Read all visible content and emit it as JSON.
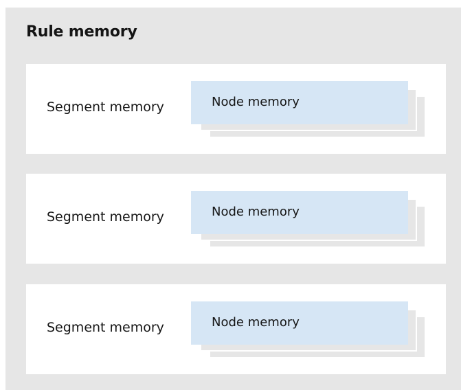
{
  "diagram": {
    "title": "Rule memory",
    "segments": [
      {
        "label": "Segment memory",
        "node_label": "Node memory"
      },
      {
        "label": "Segment memory",
        "node_label": "Node memory"
      },
      {
        "label": "Segment memory",
        "node_label": "Node memory"
      }
    ],
    "colors": {
      "outer_background": "#e6e6e6",
      "segment_background": "#ffffff",
      "node_background": "#d6e6f5",
      "text": "#151515"
    }
  }
}
